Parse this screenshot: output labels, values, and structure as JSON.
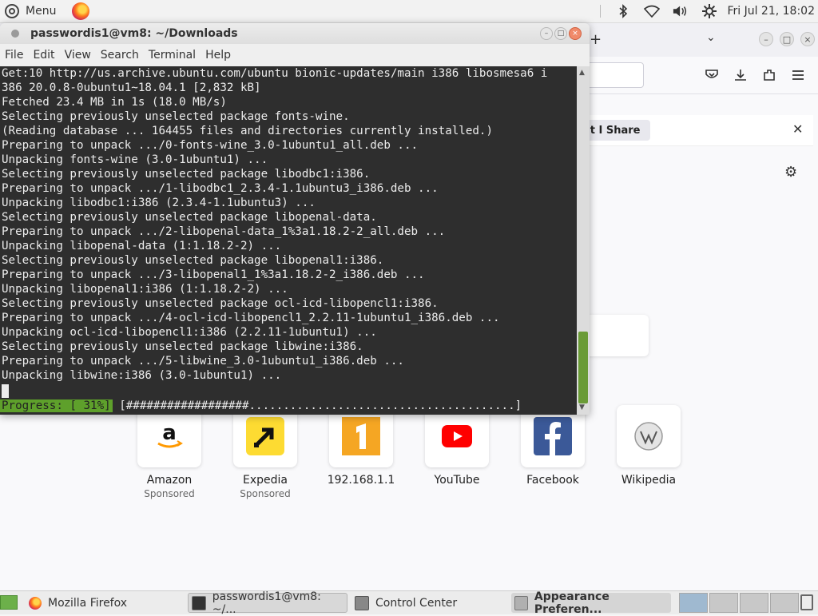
{
  "top_panel": {
    "menu_label": "Menu",
    "clock": "Fri Jul 21, 18:02",
    "tray_icons": [
      "bluetooth-icon",
      "wifi-icon",
      "volume-icon",
      "settings-icon"
    ]
  },
  "firefox": {
    "notification_text": "at I Share",
    "shortcuts": [
      {
        "name": "Amazon",
        "sub": "Sponsored",
        "icon": "amazon-icon"
      },
      {
        "name": "Expedia",
        "sub": "Sponsored",
        "icon": "expedia-icon"
      },
      {
        "name": "192.168.1.1",
        "sub": "",
        "icon": "local-site-icon"
      },
      {
        "name": "YouTube",
        "sub": "",
        "icon": "youtube-icon"
      },
      {
        "name": "Facebook",
        "sub": "",
        "icon": "facebook-icon"
      },
      {
        "name": "Wikipedia",
        "sub": "",
        "icon": "wikipedia-icon"
      }
    ]
  },
  "terminal": {
    "title": "passwordis1@vm8: ~/Downloads",
    "menu": [
      "File",
      "Edit",
      "View",
      "Search",
      "Terminal",
      "Help"
    ],
    "lines": [
      "Get:10 http://us.archive.ubuntu.com/ubuntu bionic-updates/main i386 libosmesa6 i",
      "386 20.0.8-0ubuntu1~18.04.1 [2,832 kB]",
      "Fetched 23.4 MB in 1s (18.0 MB/s)",
      "Selecting previously unselected package fonts-wine.",
      "(Reading database ... 164455 files and directories currently installed.)",
      "Preparing to unpack .../0-fonts-wine_3.0-1ubuntu1_all.deb ...",
      "Unpacking fonts-wine (3.0-1ubuntu1) ...",
      "Selecting previously unselected package libodbc1:i386.",
      "Preparing to unpack .../1-libodbc1_2.3.4-1.1ubuntu3_i386.deb ...",
      "Unpacking libodbc1:i386 (2.3.4-1.1ubuntu3) ...",
      "Selecting previously unselected package libopenal-data.",
      "Preparing to unpack .../2-libopenal-data_1%3a1.18.2-2_all.deb ...",
      "Unpacking libopenal-data (1:1.18.2-2) ...",
      "Selecting previously unselected package libopenal1:i386.",
      "Preparing to unpack .../3-libopenal1_1%3a1.18.2-2_i386.deb ...",
      "Unpacking libopenal1:i386 (1:1.18.2-2) ...",
      "Selecting previously unselected package ocl-icd-libopencl1:i386.",
      "Preparing to unpack .../4-ocl-icd-libopencl1_2.2.11-1ubuntu1_i386.deb ...",
      "Unpacking ocl-icd-libopencl1:i386 (2.2.11-1ubuntu1) ...",
      "Selecting previously unselected package libwine:i386.",
      "Preparing to unpack .../5-libwine_3.0-1ubuntu1_i386.deb ...",
      "Unpacking libwine:i386 (3.0-1ubuntu1) ..."
    ],
    "progress_label": "Progress: [ 31%]",
    "progress_bar": "[##################.......................................]",
    "progress_percent": 31
  },
  "taskbar": {
    "tasks": [
      {
        "label": "Mozilla Firefox",
        "icon": "firefox-icon"
      },
      {
        "label": "passwordis1@vm8: ~/...",
        "icon": "terminal-icon"
      },
      {
        "label": "Control Center",
        "icon": "control-center-icon"
      },
      {
        "label": "Appearance Preferen...",
        "icon": "appearance-icon"
      }
    ]
  }
}
